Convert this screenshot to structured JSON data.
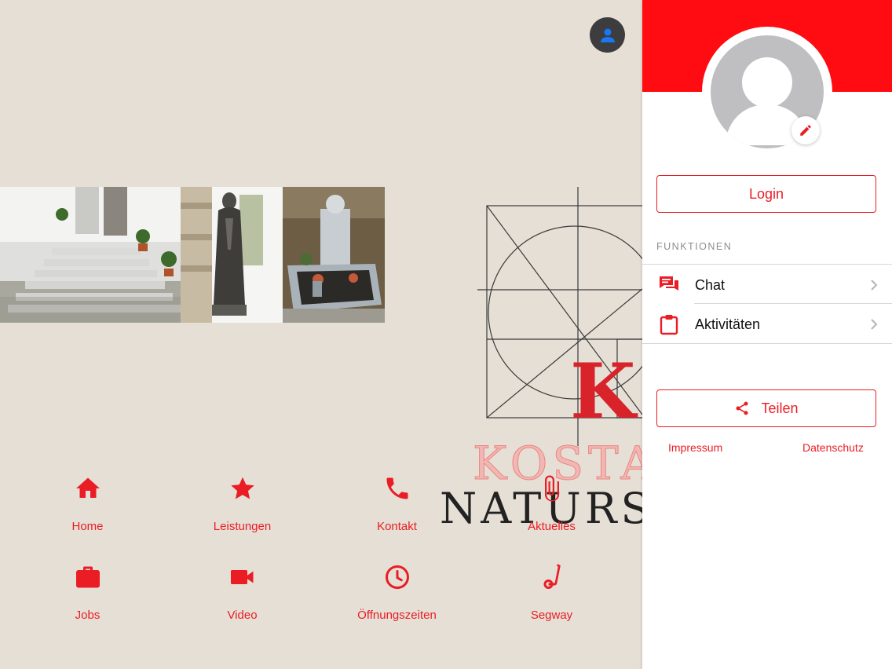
{
  "colors": {
    "accent": "#ea1d25",
    "header_red": "#ff0c12",
    "background": "#e6dfd5"
  },
  "main": {
    "profile_icon": "user-icon",
    "gallery": [
      {
        "subject": "granite entrance steps",
        "icon": "photo"
      },
      {
        "subject": "bronze madonna statue",
        "icon": "photo"
      },
      {
        "subject": "grave memorial stone",
        "icon": "photo"
      }
    ],
    "brand": {
      "line1": "KOSTA",
      "line2": "NATURST",
      "monogram": "K"
    },
    "quick_nav": [
      {
        "label": "Home",
        "icon": "home-icon"
      },
      {
        "label": "Leistungen",
        "icon": "star-icon"
      },
      {
        "label": "Kontakt",
        "icon": "phone-icon"
      },
      {
        "label": "Aktuelles",
        "icon": "paperclip-icon"
      },
      {
        "label": "Jobs",
        "icon": "briefcase-icon"
      },
      {
        "label": "Video",
        "icon": "video-camera-icon"
      },
      {
        "label": "Öffnungszeiten",
        "icon": "clock-icon"
      },
      {
        "label": "Segway",
        "icon": "segway-icon"
      }
    ]
  },
  "drawer": {
    "login_label": "Login",
    "section_title": "FUNKTIONEN",
    "menu": [
      {
        "label": "Chat",
        "icon": "chat-icon"
      },
      {
        "label": "Aktivitäten",
        "icon": "clipboard-icon"
      }
    ],
    "share_label": "Teilen",
    "impressum_label": "Impressum",
    "datenschutz_label": "Datenschutz"
  }
}
